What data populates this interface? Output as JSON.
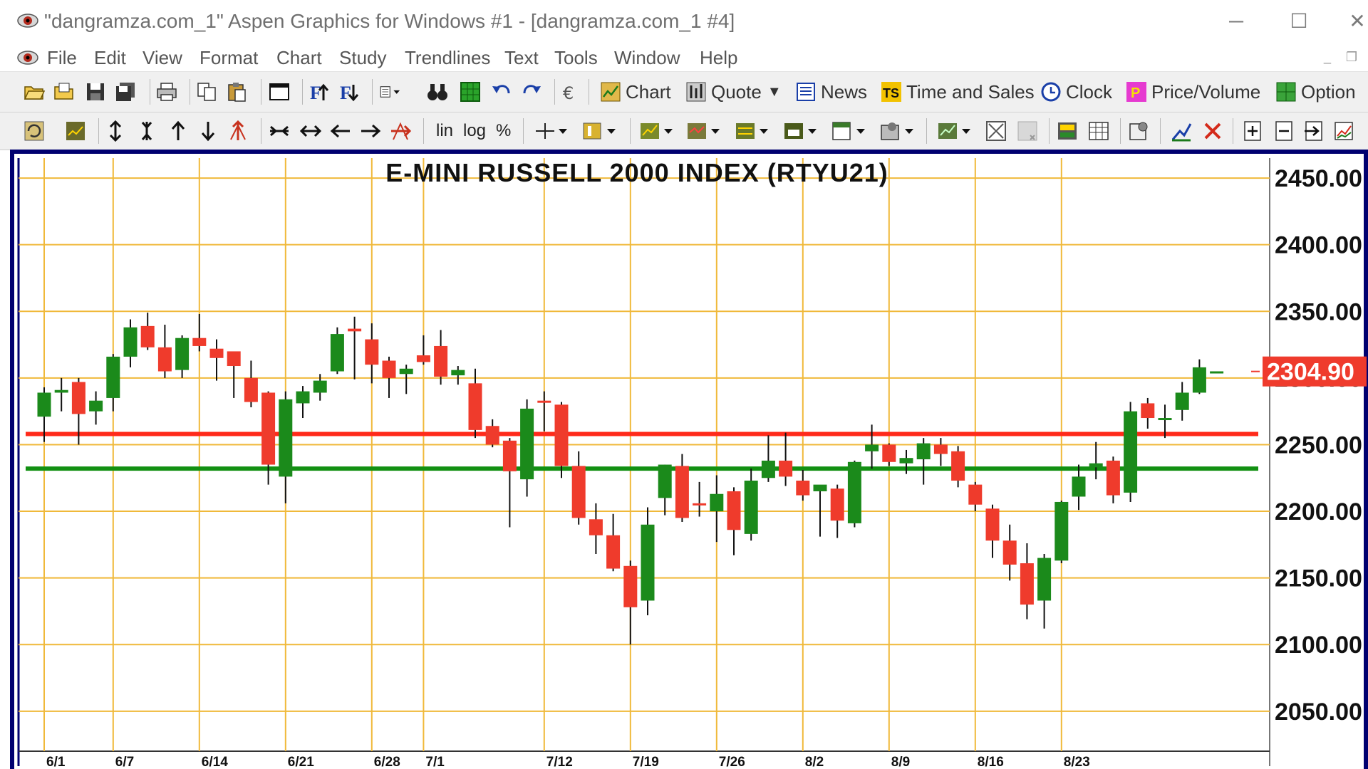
{
  "window": {
    "title": "\"dangramza.com_1\" Aspen Graphics for Windows #1 - [dangramza.com_1 #4]",
    "minimize": "─",
    "maximize": "☐",
    "close": "✕"
  },
  "menu": {
    "items": [
      "File",
      "Edit",
      "View",
      "Format",
      "Chart",
      "Study",
      "Trendlines",
      "Text",
      "Tools",
      "Window",
      "Help"
    ]
  },
  "toolbar1": {
    "buttons": [
      "Chart",
      "Quote",
      "News",
      "Time and Sales",
      "Clock",
      "Price/Volume",
      "Option"
    ]
  },
  "toolbar2": {
    "scale_lin": "lin",
    "scale_log": "log",
    "scale_pct": "%"
  },
  "colors": {
    "up": "#1b8a1b",
    "down": "#ef3b2c",
    "grid": "#f0b93a",
    "support_red": "#ff2a1a",
    "support_green": "#129012",
    "last_price_bg": "#ef3b2c"
  },
  "chart_data": {
    "type": "candlestick",
    "title": "E-MINI RUSSELL 2000 INDEX (RTYU21)",
    "ylim": [
      2020,
      2465
    ],
    "y_ticks": [
      "2050.00",
      "2100.00",
      "2150.00",
      "2200.00",
      "2250.00",
      "2300.00",
      "2350.00",
      "2400.00",
      "2450.00"
    ],
    "x_ticks": [
      "6/1",
      "6/7",
      "6/14",
      "6/21",
      "6/28",
      "7/1",
      "7/12",
      "7/19",
      "7/26",
      "8/2",
      "8/9",
      "8/16",
      "8/23"
    ],
    "x_tick_bar_index": [
      0,
      4,
      9,
      14,
      19,
      22,
      29,
      34,
      39,
      44,
      49,
      54,
      59
    ],
    "last_price": "2304.90",
    "horizontal_lines": [
      {
        "color": "red",
        "value": 2258
      },
      {
        "color": "green",
        "value": 2232
      }
    ],
    "candles": [
      [
        2271,
        2293,
        2252,
        2289
      ],
      [
        2289,
        2300,
        2275,
        2291
      ],
      [
        2297,
        2300,
        2250,
        2273
      ],
      [
        2275,
        2290,
        2265,
        2283
      ],
      [
        2285,
        2318,
        2275,
        2316
      ],
      [
        2316,
        2344,
        2308,
        2338
      ],
      [
        2339,
        2349,
        2321,
        2323
      ],
      [
        2323,
        2340,
        2300,
        2305
      ],
      [
        2306,
        2332,
        2300,
        2330
      ],
      [
        2330,
        2348,
        2320,
        2324
      ],
      [
        2322,
        2329,
        2298,
        2315
      ],
      [
        2320,
        2318,
        2285,
        2309
      ],
      [
        2300,
        2313,
        2278,
        2282
      ],
      [
        2289,
        2290,
        2220,
        2235
      ],
      [
        2226,
        2290,
        2206,
        2284
      ],
      [
        2281,
        2294,
        2270,
        2290
      ],
      [
        2289,
        2303,
        2283,
        2298
      ],
      [
        2305,
        2338,
        2303,
        2333
      ],
      [
        2337,
        2346,
        2299,
        2335
      ],
      [
        2329,
        2341,
        2296,
        2310
      ],
      [
        2313,
        2316,
        2285,
        2300
      ],
      [
        2303,
        2310,
        2288,
        2307
      ],
      [
        2317,
        2332,
        2310,
        2312
      ],
      [
        2324,
        2336,
        2295,
        2301
      ],
      [
        2302,
        2309,
        2295,
        2306
      ],
      [
        2296,
        2307,
        2255,
        2261
      ],
      [
        2264,
        2269,
        2248,
        2250
      ],
      [
        2253,
        2255,
        2188,
        2230
      ],
      [
        2224,
        2284,
        2211,
        2277
      ],
      [
        2283,
        2290,
        2260,
        2282
      ],
      [
        2280,
        2282,
        2225,
        2234
      ],
      [
        2234,
        2245,
        2190,
        2195
      ],
      [
        2194,
        2206,
        2168,
        2182
      ],
      [
        2182,
        2198,
        2155,
        2157
      ],
      [
        2159,
        2163,
        2100,
        2128
      ],
      [
        2133,
        2203,
        2122,
        2190
      ],
      [
        2210,
        2235,
        2197,
        2235
      ],
      [
        2234,
        2243,
        2192,
        2195
      ],
      [
        2206,
        2222,
        2196,
        2205
      ],
      [
        2200,
        2227,
        2177,
        2213
      ],
      [
        2215,
        2218,
        2167,
        2186
      ],
      [
        2183,
        2232,
        2178,
        2223
      ],
      [
        2225,
        2257,
        2222,
        2238
      ],
      [
        2238,
        2259,
        2219,
        2226
      ],
      [
        2223,
        2231,
        2208,
        2212
      ],
      [
        2215,
        2219,
        2181,
        2220
      ],
      [
        2217,
        2220,
        2180,
        2193
      ],
      [
        2191,
        2238,
        2188,
        2237
      ],
      [
        2245,
        2265,
        2232,
        2250
      ],
      [
        2250,
        2251,
        2234,
        2237
      ],
      [
        2236,
        2246,
        2228,
        2240
      ],
      [
        2239,
        2255,
        2220,
        2251
      ],
      [
        2250,
        2255,
        2234,
        2243
      ],
      [
        2245,
        2249,
        2218,
        2223
      ],
      [
        2220,
        2222,
        2200,
        2205
      ],
      [
        2202,
        2205,
        2165,
        2178
      ],
      [
        2178,
        2190,
        2148,
        2160
      ],
      [
        2161,
        2176,
        2119,
        2130
      ],
      [
        2133,
        2168,
        2112,
        2165
      ],
      [
        2163,
        2208,
        2161,
        2207
      ],
      [
        2211,
        2235,
        2201,
        2226
      ],
      [
        2233,
        2252,
        2224,
        2236
      ],
      [
        2238,
        2241,
        2206,
        2212
      ],
      [
        2214,
        2282,
        2207,
        2275
      ],
      [
        2281,
        2285,
        2262,
        2270
      ],
      [
        2269,
        2280,
        2255,
        2270
      ],
      [
        2276,
        2297,
        2268,
        2289
      ],
      [
        2289,
        2314,
        2288,
        2308
      ],
      [
        2304,
        2305,
        2304,
        2305
      ]
    ]
  }
}
